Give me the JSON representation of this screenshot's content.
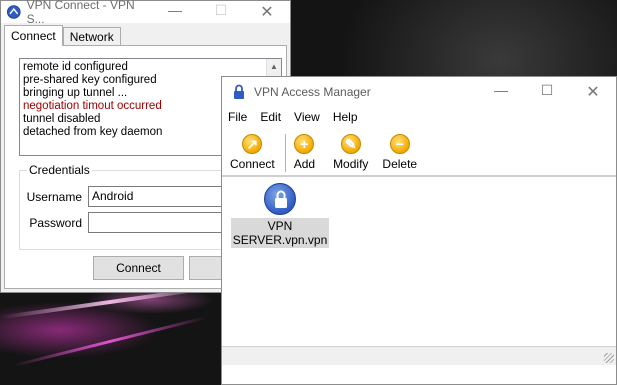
{
  "vpn_connect": {
    "title": "VPN Connect - VPN S...",
    "tabs": [
      "Connect",
      "Network"
    ],
    "log_lines": [
      {
        "text": "remote id configured",
        "error": false
      },
      {
        "text": "pre-shared key configured",
        "error": false
      },
      {
        "text": "bringing up tunnel ...",
        "error": false
      },
      {
        "text": "negotiation timout occurred",
        "error": true
      },
      {
        "text": "tunnel disabled",
        "error": false
      },
      {
        "text": "detached from key daemon",
        "error": false
      }
    ],
    "credentials": {
      "legend": "Credentials",
      "username_label": "Username",
      "username_value": "Android",
      "password_label": "Password",
      "password_value": ""
    },
    "connect_button": "Connect",
    "error_color": "#a00000"
  },
  "access_manager": {
    "title": "VPN Access Manager",
    "menu": [
      "File",
      "Edit",
      "View",
      "Help"
    ],
    "toolbar": [
      {
        "label": "Connect",
        "icon": "connect-icon"
      },
      {
        "label": "Add",
        "icon": "plus-icon"
      },
      {
        "label": "Modify",
        "icon": "wrench-icon"
      },
      {
        "label": "Delete",
        "icon": "minus-icon"
      }
    ],
    "items": [
      {
        "label_line1": "VPN",
        "label_line2": "SERVER.vpn.vpn",
        "icon": "lock-icon"
      }
    ]
  }
}
